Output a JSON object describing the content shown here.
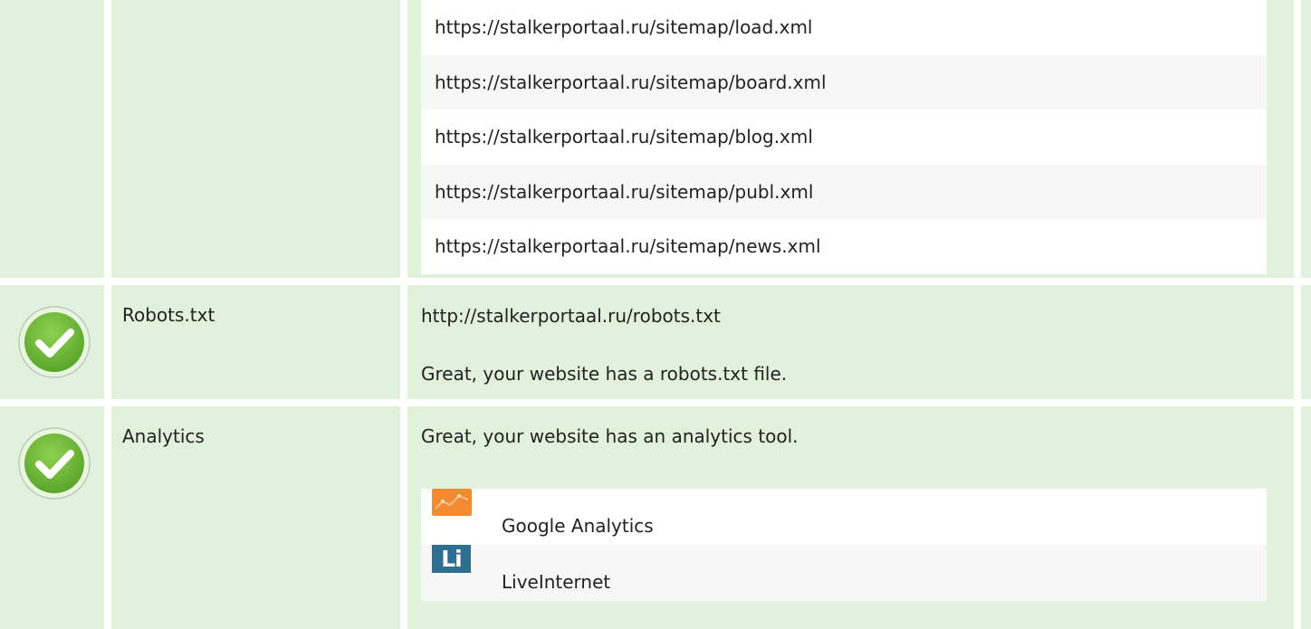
{
  "sitemaps": {
    "urls": [
      "https://stalkerportaal.ru/sitemap/load.xml",
      "https://stalkerportaal.ru/sitemap/board.xml",
      "https://stalkerportaal.ru/sitemap/blog.xml",
      "https://stalkerportaal.ru/sitemap/publ.xml",
      "https://stalkerportaal.ru/sitemap/news.xml"
    ]
  },
  "robots": {
    "label": "Robots.txt",
    "url": "http://stalkerportaal.ru/robots.txt",
    "message": "Great, your website has a robots.txt file.",
    "status_icon": "check-circle-icon"
  },
  "analytics": {
    "label": "Analytics",
    "message": "Great, your website has an analytics tool.",
    "status_icon": "check-circle-icon",
    "tools": [
      {
        "name": "Google Analytics",
        "icon": "google-analytics-icon"
      },
      {
        "name": "LiveInternet",
        "icon": "liveinternet-icon",
        "icon_text": "Li"
      }
    ]
  },
  "colors": {
    "row_background": "#e1f1db",
    "check_green": "#6cbf3a",
    "ga_orange": "#f28b30",
    "li_blue": "#2e6e91"
  }
}
